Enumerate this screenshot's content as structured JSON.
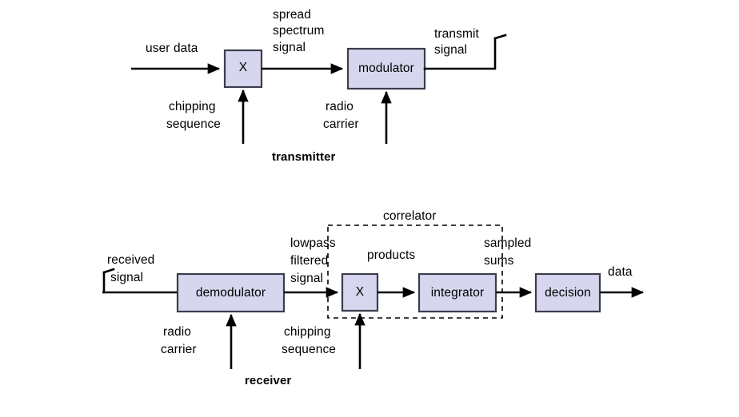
{
  "figure": {
    "title": "DSSS transmitter and receiver block diagram",
    "background_color": "#ffffff",
    "box_fill_color": "#d6d6ef",
    "box_border_color": "#3c3c4c",
    "line_color": "#000000"
  },
  "transmitter": {
    "section_label": "transmitter",
    "blocks": [
      {
        "id": "tx-multiplier",
        "label": "X"
      },
      {
        "id": "tx-modulator",
        "label": "modulator"
      }
    ],
    "signals": {
      "input": "user data",
      "spread": "spread\nspectrum\nsignal",
      "spread_line1": "spread",
      "spread_line2": "spectrum",
      "spread_line3": "signal",
      "output_line1": "transmit",
      "output_line2": "signal",
      "chipping_line1": "chipping",
      "chipping_line2": "sequence",
      "carrier_line1": "radio",
      "carrier_line2": "carrier"
    }
  },
  "receiver": {
    "section_label": "receiver",
    "group_label": "correlator",
    "blocks": [
      {
        "id": "rx-demodulator",
        "label": "demodulator"
      },
      {
        "id": "rx-multiplier",
        "label": "X"
      },
      {
        "id": "rx-integrator",
        "label": "integrator"
      },
      {
        "id": "rx-decision",
        "label": "decision"
      }
    ],
    "signals": {
      "input_line1": "received",
      "input_line2": "signal",
      "lowpass_line1": "lowpass",
      "lowpass_line2": "filtered",
      "lowpass_line3": "signal",
      "products": "products",
      "sampled_line1": "sampled",
      "sampled_line2": "sums",
      "output": "data",
      "carrier_line1": "radio",
      "carrier_line2": "carrier",
      "chipping_line1": "chipping",
      "chipping_line2": "sequence"
    }
  }
}
